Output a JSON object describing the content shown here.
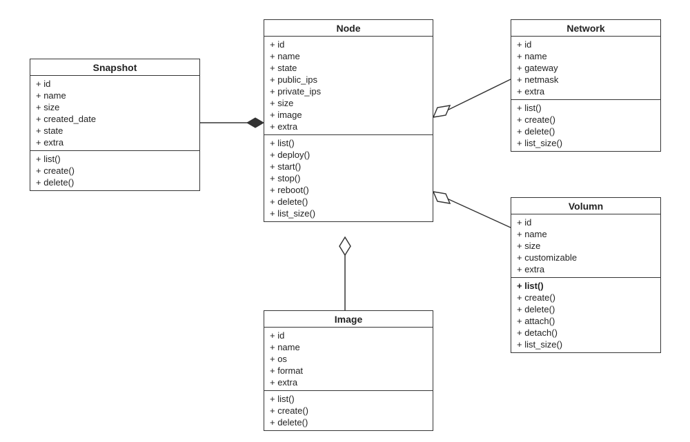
{
  "classes": {
    "snapshot": {
      "title": "Snapshot",
      "attributes": [
        "+ id",
        "+ name",
        "+ size",
        "+ created_date",
        "+ state",
        "+ extra"
      ],
      "methods": [
        "+ list()",
        "+ create()",
        "+ delete()"
      ]
    },
    "node": {
      "title": "Node",
      "attributes": [
        "+ id",
        "+ name",
        "+ state",
        "+ public_ips",
        "+ private_ips",
        "+ size",
        "+ image",
        "+ extra"
      ],
      "methods": [
        "+ list()",
        "+ deploy()",
        "+ start()",
        "+ stop()",
        "+ reboot()",
        "+ delete()",
        "+ list_size()"
      ]
    },
    "network": {
      "title": "Network",
      "attributes": [
        "+ id",
        "+ name",
        "+ gateway",
        "+ netmask",
        "+ extra"
      ],
      "methods": [
        "+ list()",
        "+ create()",
        "+ delete()",
        "+ list_size()"
      ]
    },
    "volumn": {
      "title": "Volumn",
      "attributes": [
        "+ id",
        "+ name",
        "+ size",
        "+ customizable",
        "+ extra"
      ],
      "methods_bold_first": "+ list()",
      "methods_rest": [
        "+ create()",
        "+ delete()",
        "+ attach()",
        "+ detach()",
        "+ list_size()"
      ]
    },
    "image": {
      "title": "Image",
      "attributes": [
        "+ id",
        "+ name",
        "+ os",
        "+ format",
        "+ extra"
      ],
      "methods": [
        "+ list()",
        "+ create()",
        "+ delete()"
      ]
    }
  },
  "relationships": [
    {
      "from": "Snapshot",
      "to": "Node",
      "type": "composition-solid-diamond",
      "end": "Node-left"
    },
    {
      "from": "Network",
      "to": "Node",
      "type": "aggregation-open-diamond",
      "end": "Node-right-upper"
    },
    {
      "from": "Volumn",
      "to": "Node",
      "type": "aggregation-open-diamond",
      "end": "Node-right-lower"
    },
    {
      "from": "Image",
      "to": "Node",
      "type": "aggregation-open-diamond",
      "end": "Node-bottom"
    }
  ]
}
